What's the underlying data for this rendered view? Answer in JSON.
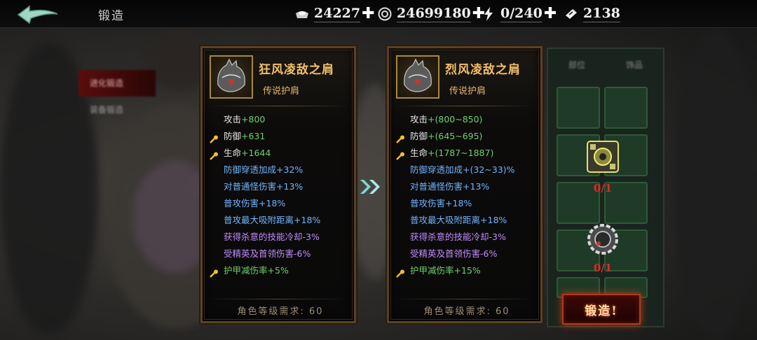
{
  "header": {
    "title": "锻造",
    "resources": [
      {
        "icon": "silver-ingot-icon",
        "value": "24227"
      },
      {
        "icon": "coin-icon",
        "value": "24699180"
      },
      {
        "icon": "lightning-icon",
        "value": "0/240"
      },
      {
        "icon": "ticket-icon",
        "value": "2138"
      }
    ]
  },
  "left_menu": {
    "items": [
      "进化锻造",
      "装备锻造",
      "",
      "",
      "",
      ""
    ]
  },
  "grid": {
    "headers": [
      "部位",
      "饰品"
    ]
  },
  "current_item": {
    "name": "狂风凌敌之肩",
    "type": "传说护肩",
    "attrs": [
      {
        "name": "攻击",
        "value": "+800",
        "style": "base",
        "key": false
      },
      {
        "name": "防御",
        "value": "+631",
        "style": "base",
        "key": true
      },
      {
        "name": "生命",
        "value": "+1644",
        "style": "base",
        "key": true
      },
      {
        "name": "防御穿透加成",
        "value": "+32%",
        "style": "blue",
        "key": false
      },
      {
        "name": "对普通怪伤害",
        "value": "+13%",
        "style": "blue",
        "key": false
      },
      {
        "name": "普攻伤害",
        "value": "+18%",
        "style": "blue",
        "key": false
      },
      {
        "name": "普攻最大吸附距离",
        "value": "+18%",
        "style": "blue",
        "key": false
      },
      {
        "name": "获得杀意的技能冷却",
        "value": "-3%",
        "style": "purple",
        "key": false
      },
      {
        "name": "受精英及首领伤害",
        "value": "-6%",
        "style": "purple",
        "key": false
      },
      {
        "name": "护甲减伤率",
        "value": "+5%",
        "style": "green",
        "key": true
      }
    ],
    "requirement": "角色等级需求: 60"
  },
  "next_item": {
    "name": "烈风凌敌之肩",
    "type": "传说护肩",
    "attrs": [
      {
        "name": "攻击",
        "value": "+(800~850)",
        "style": "base",
        "key": false
      },
      {
        "name": "防御",
        "value": "+(645~695)",
        "style": "base",
        "key": true
      },
      {
        "name": "生命",
        "value": "+(1787~1887)",
        "style": "base",
        "key": true
      },
      {
        "name": "防御穿透加成",
        "value": "+(32~33)%",
        "style": "blue",
        "key": false
      },
      {
        "name": "对普通怪伤害",
        "value": "+13%",
        "style": "blue",
        "key": false
      },
      {
        "name": "普攻伤害",
        "value": "+18%",
        "style": "blue",
        "key": false
      },
      {
        "name": "普攻最大吸附距离",
        "value": "+18%",
        "style": "blue",
        "key": false
      },
      {
        "name": "获得杀意的技能冷却",
        "value": "-3%",
        "style": "purple",
        "key": false
      },
      {
        "name": "受精英及首领伤害",
        "value": "-6%",
        "style": "purple",
        "key": false
      },
      {
        "name": "护甲减伤率",
        "value": "+15%",
        "style": "green",
        "key": true
      }
    ],
    "requirement": "角色等级需求: 60"
  },
  "materials": [
    {
      "icon": "gear-box-material-icon",
      "count": "0/1"
    },
    {
      "icon": "cog-ring-material-icon",
      "count": "0/1"
    }
  ],
  "forge_button": {
    "label": "锻造!"
  },
  "colors": {
    "gold": "#f3c06a",
    "blue_attr": "#6fb5ff",
    "purple_attr": "#c28cff",
    "green_attr": "#6fcf6f",
    "missing": "#e02a2a"
  }
}
